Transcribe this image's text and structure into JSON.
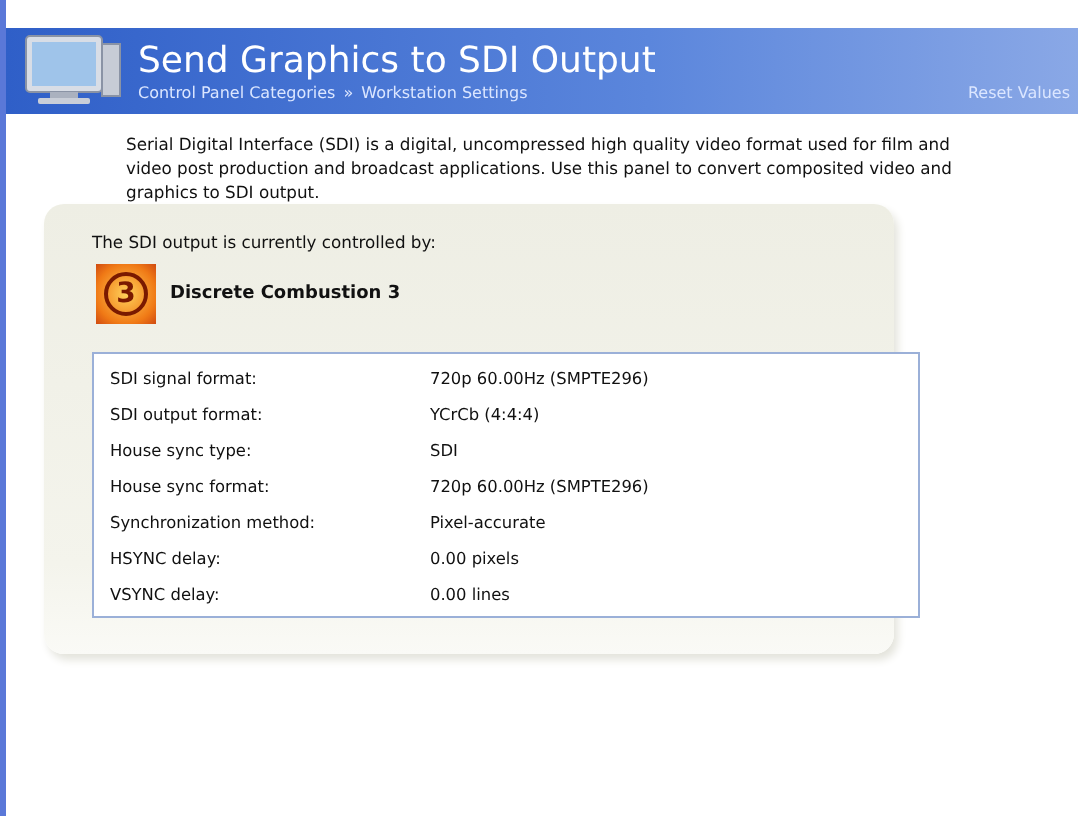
{
  "header": {
    "title": "Send Graphics to SDI Output",
    "breadcrumb": [
      "Control Panel Categories",
      "Workstation Settings"
    ],
    "breadcrumb_separator": "»",
    "action": "Reset Values"
  },
  "description": "Serial Digital Interface (SDI) is a digital, uncompressed high quality video format used for film and video post production and broadcast applications. Use this panel to convert composited video and graphics to SDI output.",
  "panel": {
    "caption": "The SDI output is currently controlled by:",
    "application": {
      "badge": "3",
      "name": "Discrete Combustion 3"
    },
    "properties": [
      {
        "label": "SDI signal format:",
        "value": "720p 60.00Hz (SMPTE296)"
      },
      {
        "label": "SDI output format:",
        "value": "YCrCb (4:4:4)"
      },
      {
        "label": "House sync type:",
        "value": "SDI"
      },
      {
        "label": "House sync format:",
        "value": "720p 60.00Hz (SMPTE296)"
      },
      {
        "label": "Synchronization method:",
        "value": "Pixel-accurate"
      },
      {
        "label": "HSYNC delay:",
        "value": "0.00 pixels"
      },
      {
        "label": "VSYNC delay:",
        "value": "0.00 lines"
      }
    ]
  }
}
